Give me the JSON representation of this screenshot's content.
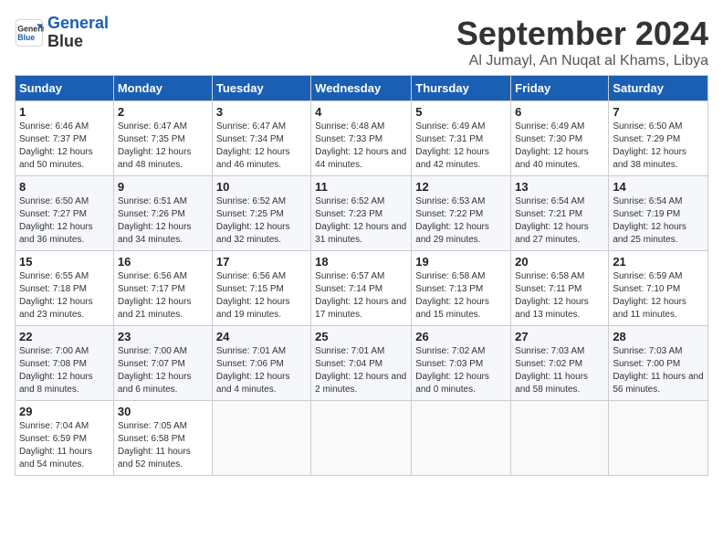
{
  "logo": {
    "line1": "General",
    "line2": "Blue"
  },
  "title": "September 2024",
  "subtitle": "Al Jumayl, An Nuqat al Khams, Libya",
  "headers": [
    "Sunday",
    "Monday",
    "Tuesday",
    "Wednesday",
    "Thursday",
    "Friday",
    "Saturday"
  ],
  "weeks": [
    [
      {
        "day": "1",
        "sunrise": "6:46 AM",
        "sunset": "7:37 PM",
        "daylight": "12 hours and 50 minutes."
      },
      {
        "day": "2",
        "sunrise": "6:47 AM",
        "sunset": "7:35 PM",
        "daylight": "12 hours and 48 minutes."
      },
      {
        "day": "3",
        "sunrise": "6:47 AM",
        "sunset": "7:34 PM",
        "daylight": "12 hours and 46 minutes."
      },
      {
        "day": "4",
        "sunrise": "6:48 AM",
        "sunset": "7:33 PM",
        "daylight": "12 hours and 44 minutes."
      },
      {
        "day": "5",
        "sunrise": "6:49 AM",
        "sunset": "7:31 PM",
        "daylight": "12 hours and 42 minutes."
      },
      {
        "day": "6",
        "sunrise": "6:49 AM",
        "sunset": "7:30 PM",
        "daylight": "12 hours and 40 minutes."
      },
      {
        "day": "7",
        "sunrise": "6:50 AM",
        "sunset": "7:29 PM",
        "daylight": "12 hours and 38 minutes."
      }
    ],
    [
      {
        "day": "8",
        "sunrise": "6:50 AM",
        "sunset": "7:27 PM",
        "daylight": "12 hours and 36 minutes."
      },
      {
        "day": "9",
        "sunrise": "6:51 AM",
        "sunset": "7:26 PM",
        "daylight": "12 hours and 34 minutes."
      },
      {
        "day": "10",
        "sunrise": "6:52 AM",
        "sunset": "7:25 PM",
        "daylight": "12 hours and 32 minutes."
      },
      {
        "day": "11",
        "sunrise": "6:52 AM",
        "sunset": "7:23 PM",
        "daylight": "12 hours and 31 minutes."
      },
      {
        "day": "12",
        "sunrise": "6:53 AM",
        "sunset": "7:22 PM",
        "daylight": "12 hours and 29 minutes."
      },
      {
        "day": "13",
        "sunrise": "6:54 AM",
        "sunset": "7:21 PM",
        "daylight": "12 hours and 27 minutes."
      },
      {
        "day": "14",
        "sunrise": "6:54 AM",
        "sunset": "7:19 PM",
        "daylight": "12 hours and 25 minutes."
      }
    ],
    [
      {
        "day": "15",
        "sunrise": "6:55 AM",
        "sunset": "7:18 PM",
        "daylight": "12 hours and 23 minutes."
      },
      {
        "day": "16",
        "sunrise": "6:56 AM",
        "sunset": "7:17 PM",
        "daylight": "12 hours and 21 minutes."
      },
      {
        "day": "17",
        "sunrise": "6:56 AM",
        "sunset": "7:15 PM",
        "daylight": "12 hours and 19 minutes."
      },
      {
        "day": "18",
        "sunrise": "6:57 AM",
        "sunset": "7:14 PM",
        "daylight": "12 hours and 17 minutes."
      },
      {
        "day": "19",
        "sunrise": "6:58 AM",
        "sunset": "7:13 PM",
        "daylight": "12 hours and 15 minutes."
      },
      {
        "day": "20",
        "sunrise": "6:58 AM",
        "sunset": "7:11 PM",
        "daylight": "12 hours and 13 minutes."
      },
      {
        "day": "21",
        "sunrise": "6:59 AM",
        "sunset": "7:10 PM",
        "daylight": "12 hours and 11 minutes."
      }
    ],
    [
      {
        "day": "22",
        "sunrise": "7:00 AM",
        "sunset": "7:08 PM",
        "daylight": "12 hours and 8 minutes."
      },
      {
        "day": "23",
        "sunrise": "7:00 AM",
        "sunset": "7:07 PM",
        "daylight": "12 hours and 6 minutes."
      },
      {
        "day": "24",
        "sunrise": "7:01 AM",
        "sunset": "7:06 PM",
        "daylight": "12 hours and 4 minutes."
      },
      {
        "day": "25",
        "sunrise": "7:01 AM",
        "sunset": "7:04 PM",
        "daylight": "12 hours and 2 minutes."
      },
      {
        "day": "26",
        "sunrise": "7:02 AM",
        "sunset": "7:03 PM",
        "daylight": "12 hours and 0 minutes."
      },
      {
        "day": "27",
        "sunrise": "7:03 AM",
        "sunset": "7:02 PM",
        "daylight": "11 hours and 58 minutes."
      },
      {
        "day": "28",
        "sunrise": "7:03 AM",
        "sunset": "7:00 PM",
        "daylight": "11 hours and 56 minutes."
      }
    ],
    [
      {
        "day": "29",
        "sunrise": "7:04 AM",
        "sunset": "6:59 PM",
        "daylight": "11 hours and 54 minutes."
      },
      {
        "day": "30",
        "sunrise": "7:05 AM",
        "sunset": "6:58 PM",
        "daylight": "11 hours and 52 minutes."
      },
      null,
      null,
      null,
      null,
      null
    ]
  ],
  "labels": {
    "sunrise": "Sunrise:",
    "sunset": "Sunset:",
    "daylight": "Daylight:"
  }
}
